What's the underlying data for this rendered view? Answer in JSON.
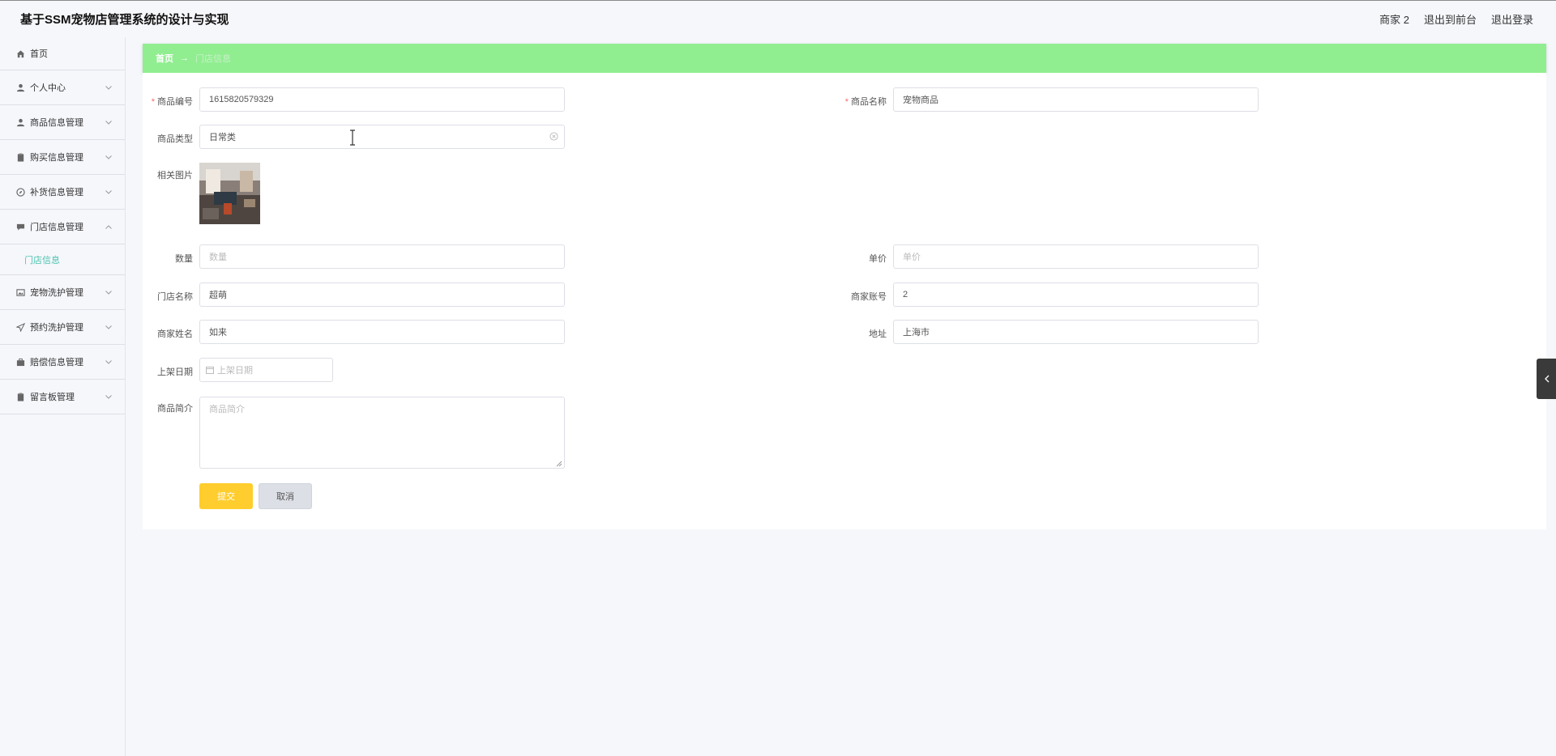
{
  "header": {
    "title": "基于SSM宠物店管理系统的设计与实现",
    "user": "商家 2",
    "to_front": "退出到前台",
    "logout": "退出登录"
  },
  "sidebar": {
    "items": [
      {
        "label": "首页",
        "icon": "home-icon"
      },
      {
        "label": "个人中心",
        "icon": "user-icon"
      },
      {
        "label": "商品信息管理",
        "icon": "user-icon"
      },
      {
        "label": "购买信息管理",
        "icon": "clipboard-icon"
      },
      {
        "label": "补货信息管理",
        "icon": "compass-icon"
      },
      {
        "label": "门店信息管理",
        "icon": "chat-icon"
      },
      {
        "label": "宠物洗护管理",
        "icon": "image-icon"
      },
      {
        "label": "预约洗护管理",
        "icon": "send-icon"
      },
      {
        "label": "赔偿信息管理",
        "icon": "briefcase-icon"
      },
      {
        "label": "留言板管理",
        "icon": "clipboard-icon"
      }
    ],
    "submenu_label": "门店信息"
  },
  "breadcrumb": {
    "home": "首页",
    "separator": "→",
    "current": "门店信息"
  },
  "form": {
    "product_no": {
      "label": "商品编号",
      "value": "1615820579329"
    },
    "product_name": {
      "label": "商品名称",
      "value": "宠物商品"
    },
    "product_type": {
      "label": "商品类型",
      "value": "日常类"
    },
    "photo": {
      "label": "相关图片"
    },
    "quantity": {
      "label": "数量",
      "placeholder": "数量"
    },
    "unit_price": {
      "label": "单价",
      "placeholder": "单价"
    },
    "store_name": {
      "label": "门店名称",
      "value": "超萌"
    },
    "merchant_account": {
      "label": "商家账号",
      "value": "2"
    },
    "merchant_name": {
      "label": "商家姓名",
      "value": "如来"
    },
    "address": {
      "label": "地址",
      "value": "上海市"
    },
    "listing_date": {
      "label": "上架日期",
      "placeholder": "上架日期"
    },
    "intro": {
      "label": "商品简介",
      "placeholder": "商品简介"
    },
    "submit": "提交",
    "cancel": "取消"
  },
  "colors": {
    "breadcrumb_bg": "#90ee90",
    "submit_bg": "#ffcd2d",
    "active_submenu": "#4cc3b0",
    "required": "#f56c6c"
  }
}
